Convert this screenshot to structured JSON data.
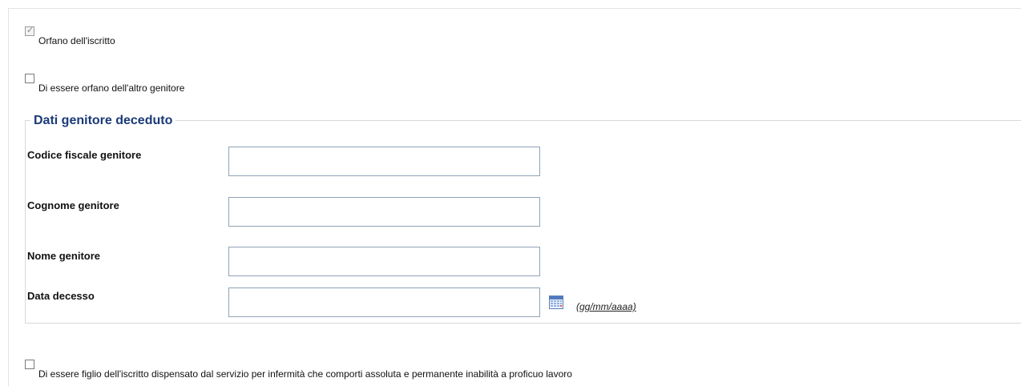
{
  "options": {
    "orfano_iscritto": {
      "label": "Orfano dell'iscritto",
      "checked": true
    },
    "orfano_altro_genitore": {
      "label": "Di essere orfano dell'altro genitore",
      "checked": false
    },
    "figlio_dispensato": {
      "label": "Di essere figlio dell'iscritto dispensato dal servizio per infermità che comporti assoluta e permanente inabilità a proficuo lavoro",
      "checked": false
    }
  },
  "fieldset": {
    "legend": "Dati genitore deceduto",
    "fields": {
      "codice_fiscale": {
        "label": "Codice fiscale genitore",
        "value": ""
      },
      "cognome": {
        "label": "Cognome genitore",
        "value": ""
      },
      "nome": {
        "label": "Nome genitore",
        "value": ""
      },
      "data_decesso": {
        "label": "Data decesso",
        "value": "",
        "format_hint": "(gg/mm/aaaa)"
      }
    }
  },
  "icons": {
    "calendar": "calendar-icon",
    "checkmark": "check-icon"
  },
  "colors": {
    "legend": "#1a3a78",
    "input_border": "#8fa3b8"
  }
}
